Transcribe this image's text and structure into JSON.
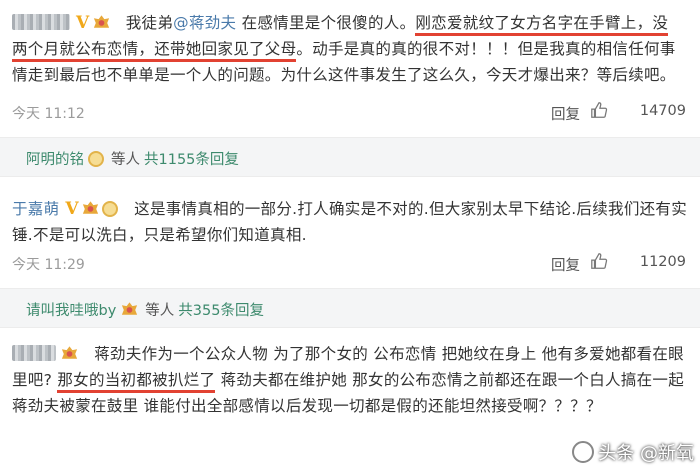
{
  "comments": [
    {
      "segments": {
        "a": "我徒弟",
        "mention": "@蒋劲夫",
        "b": " 在感情里是个很傻的人。",
        "u1": "刚恋爱就纹了女方名字在手臂上，没",
        "u2": "两个月就公布恋情，还带她回家见了父母",
        "c": "。动手是真的真的很不对！！！但是我真的相信任何事情走到最后也不单单是一个人的问题。为什么这件事发生了这么久，今天才爆出来？等后续吧。"
      },
      "time": "今天 11:12",
      "reply_label": "回复",
      "likes": "14709"
    },
    {
      "user_name": "于嘉萌",
      "text": "这是事情真相的一部分.打人确实是不对的.但大家别太早下结论.后续我们还有实锤.不是可以洗白，只是希望你们知道真相.",
      "time": "今天 11:29",
      "reply_label": "回复",
      "likes": "11209"
    },
    {
      "segments": {
        "a": "蒋劲夫作为一个公众人物 为了那个女的 公布恋情 把她纹在身上 他有多爱她都看在眼里吧? ",
        "u1": "那女的当初都被扒烂了",
        "b": " 蒋劲夫都在维护她 那女的公布恋情之前都还在跟一个白人搞在一起 蒋劲夫被蒙在鼓里 谁能付出全部感情以后发现一切都是假的还能坦然接受啊？？？？"
      }
    }
  ],
  "reply_bars": [
    {
      "name": "阿明的铭",
      "etc": "等人",
      "count": "共1155条回复"
    },
    {
      "name": "请叫我哇哦by",
      "etc": "等人",
      "count": "共355条回复"
    }
  ],
  "watermark": "头条 @新氧",
  "icons": {
    "like": "thumbs-up-icon",
    "vip": "v-badge-icon",
    "member": "member-badge-icon",
    "medal": "medal-icon"
  },
  "colors": {
    "link": "#4a7aaa",
    "reply_name": "#3d8a6d",
    "highlight": "#e24232",
    "badge": "#f0a81a"
  }
}
